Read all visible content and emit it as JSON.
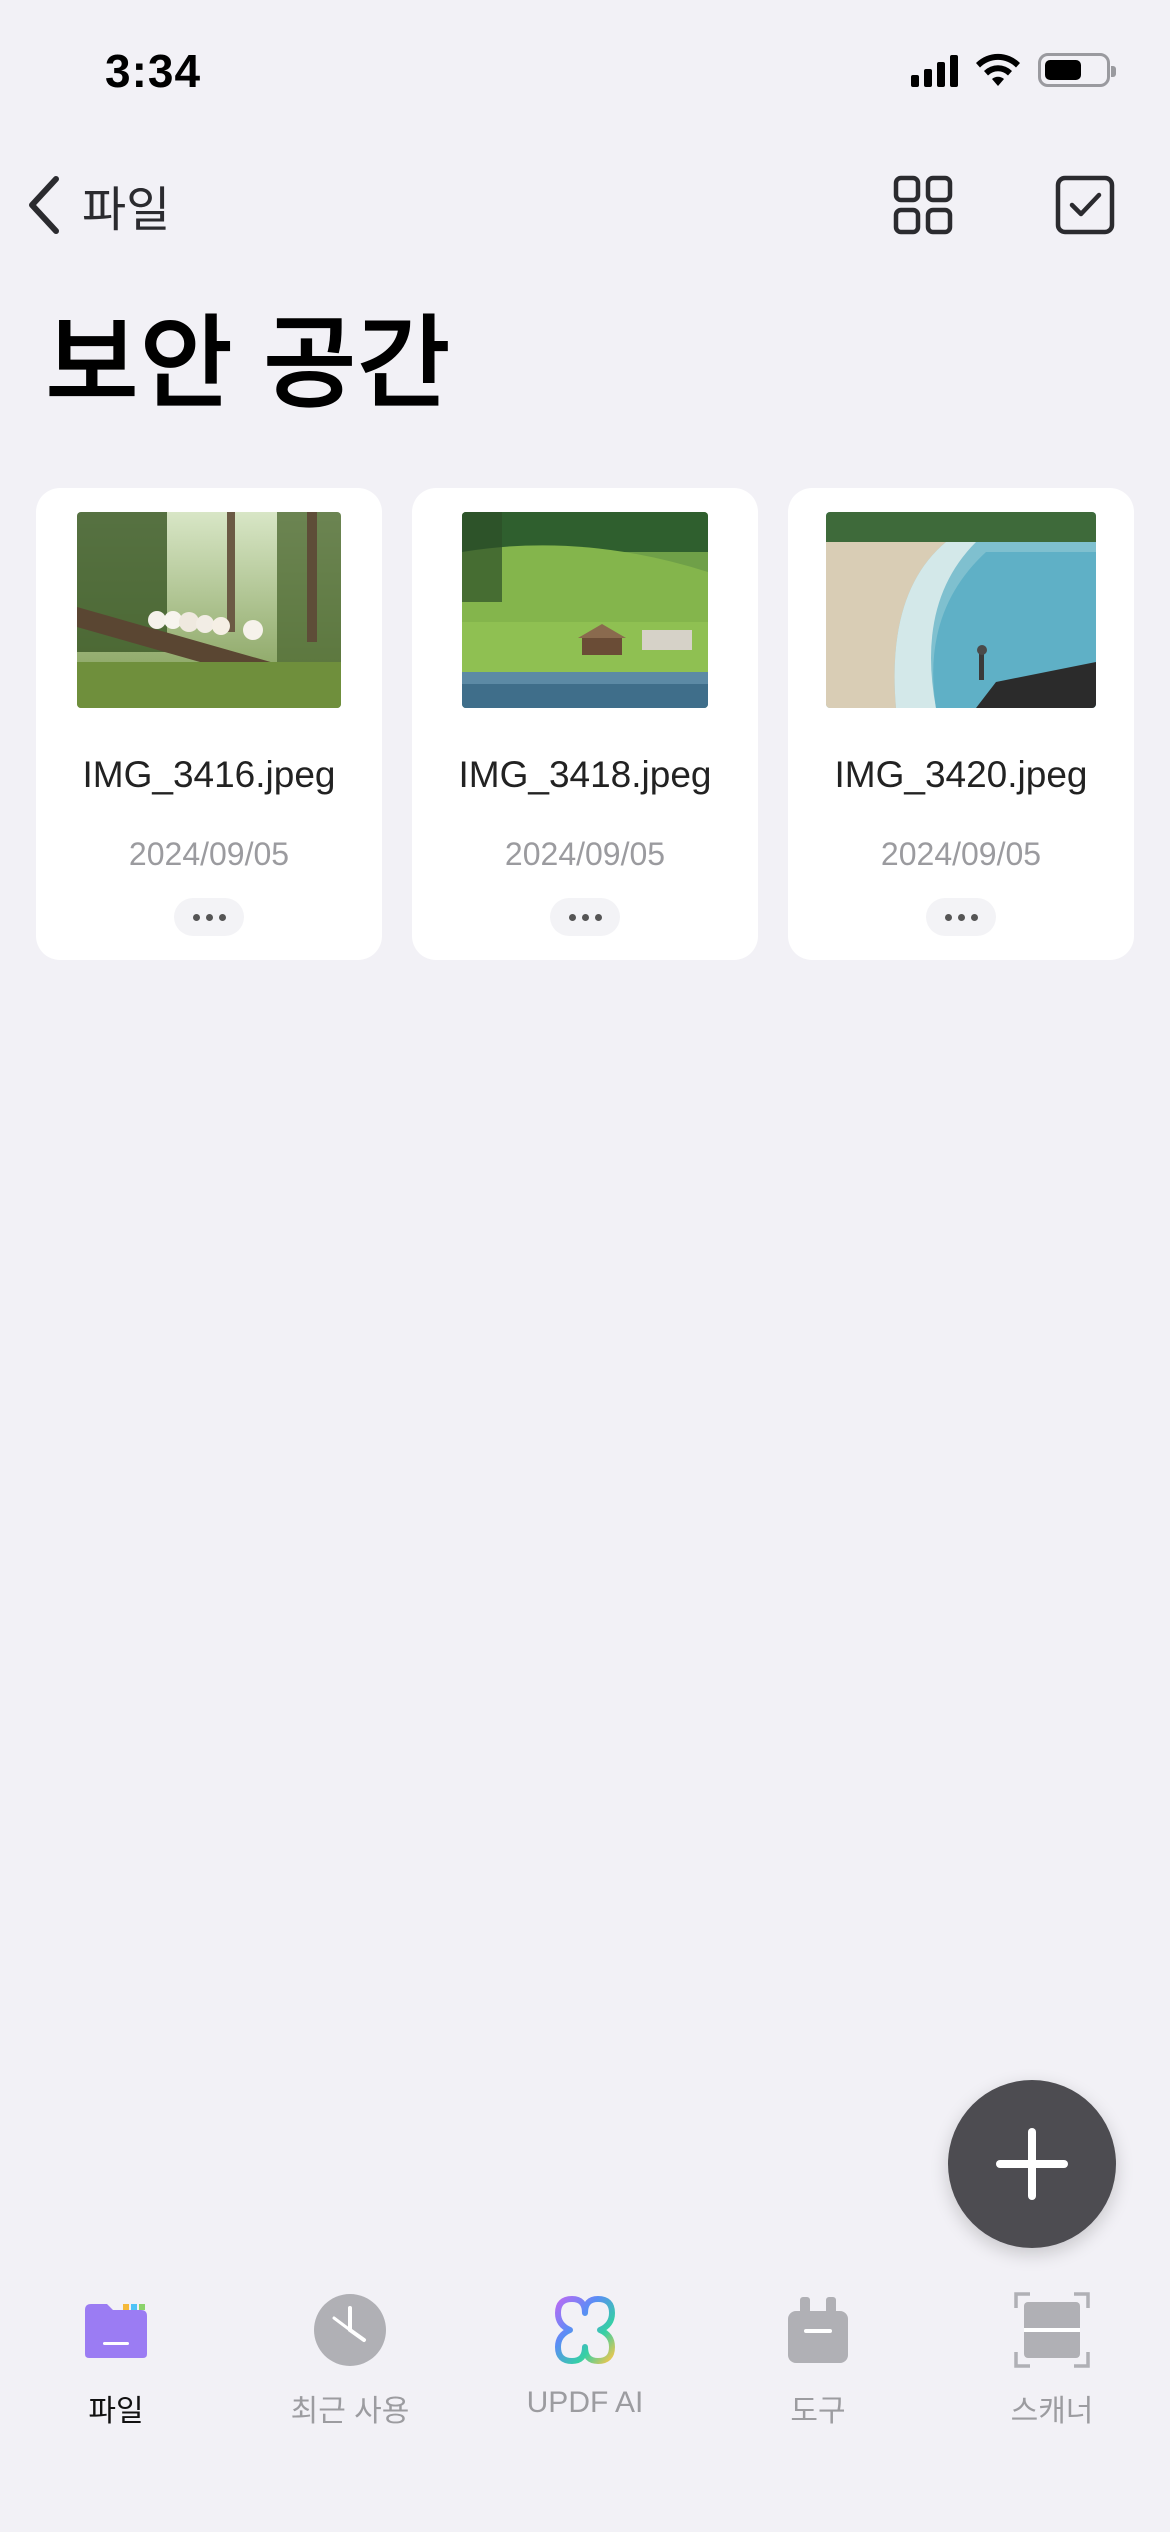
{
  "status_bar": {
    "time": "3:34",
    "battery_level": 0.62
  },
  "nav": {
    "back_label": "파일"
  },
  "page": {
    "title": "보안 공간"
  },
  "files": [
    {
      "name": "IMG_3416.jpeg",
      "date": "2024/09/05"
    },
    {
      "name": "IMG_3418.jpeg",
      "date": "2024/09/05"
    },
    {
      "name": "IMG_3420.jpeg",
      "date": "2024/09/05"
    }
  ],
  "tabs": [
    {
      "label": "파일",
      "icon": "folder-icon",
      "active": true
    },
    {
      "label": "최근 사용",
      "icon": "clock-icon",
      "active": false
    },
    {
      "label": "UPDF AI",
      "icon": "updf-ai-icon",
      "active": false
    },
    {
      "label": "도구",
      "icon": "toolbox-icon",
      "active": false
    },
    {
      "label": "스캐너",
      "icon": "scanner-icon",
      "active": false
    }
  ],
  "colors": {
    "background": "#f2f1f6",
    "accent": "#9b7cf3",
    "fab": "#4d4c51"
  }
}
